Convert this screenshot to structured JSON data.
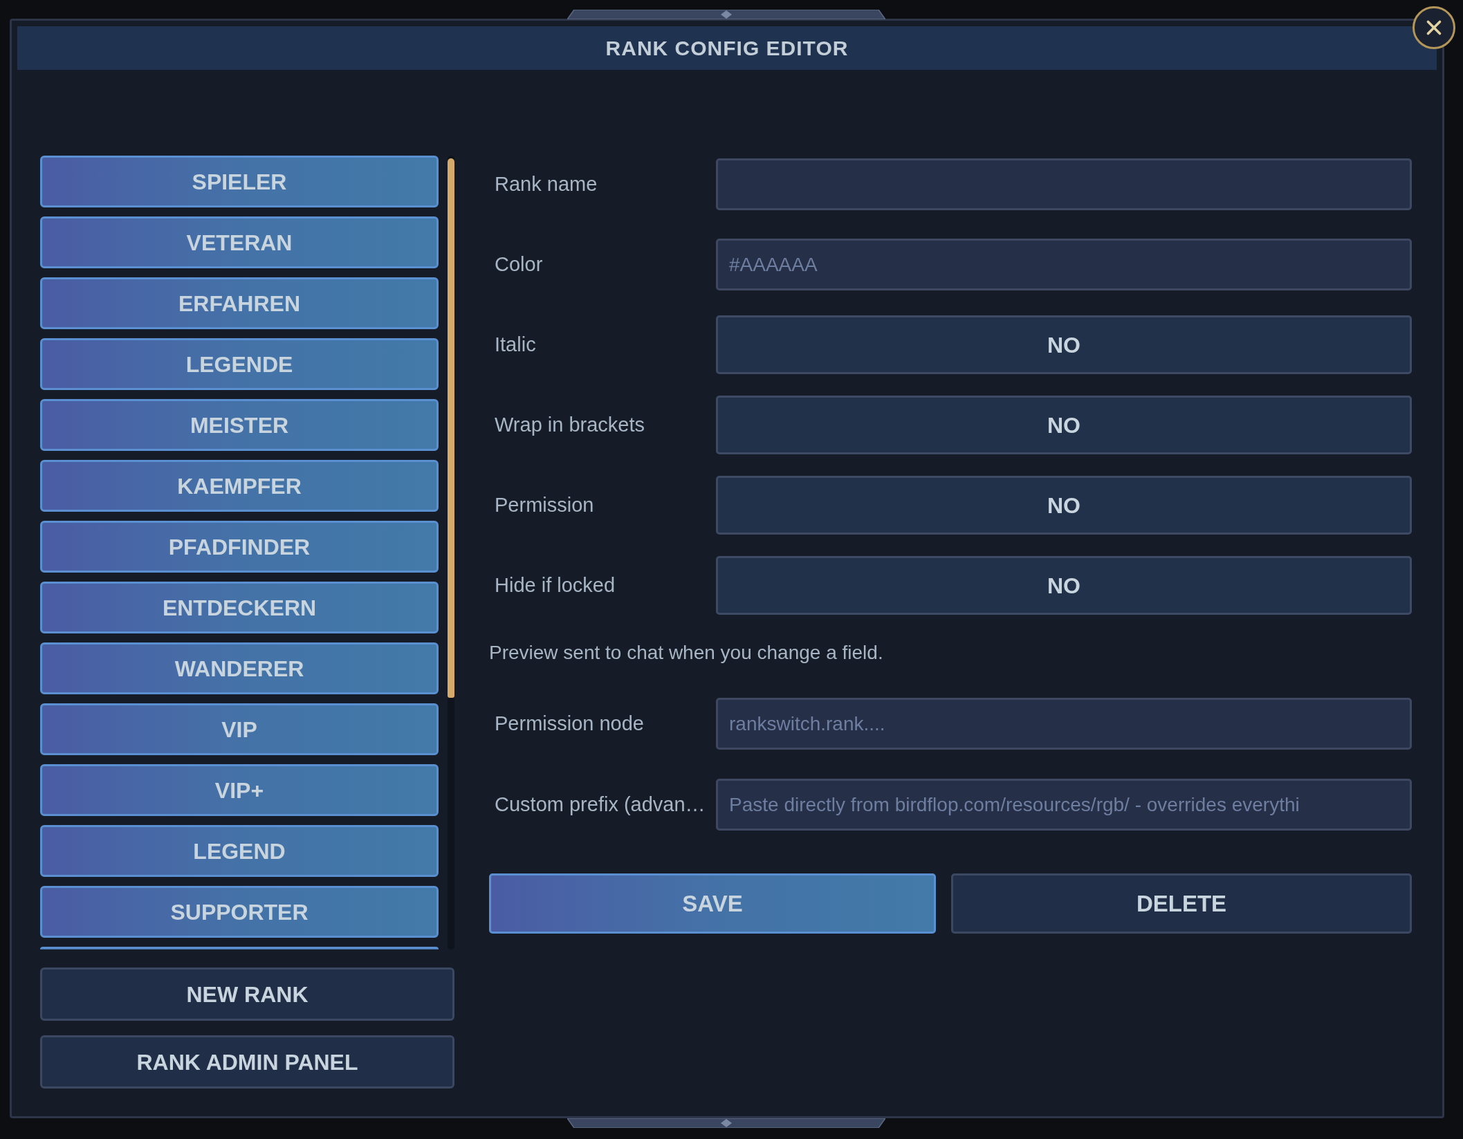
{
  "window": {
    "title": "RANK CONFIG EDITOR"
  },
  "ranks": [
    {
      "label": "SPIELER"
    },
    {
      "label": "VETERAN"
    },
    {
      "label": "ERFAHREN"
    },
    {
      "label": "LEGENDE"
    },
    {
      "label": "MEISTER"
    },
    {
      "label": "KAEMPFER"
    },
    {
      "label": "PFADFINDER"
    },
    {
      "label": "ENTDECKERN"
    },
    {
      "label": "WANDERER"
    },
    {
      "label": "VIP"
    },
    {
      "label": "VIP+"
    },
    {
      "label": "LEGEND"
    },
    {
      "label": "SUPPORTER"
    }
  ],
  "rank_actions": [
    {
      "label": "NEW RANK"
    },
    {
      "label": "RANK ADMIN PANEL"
    }
  ],
  "fields": [
    {
      "kind": "text",
      "label": "Rank name"
    },
    {
      "kind": "text",
      "label": "Color",
      "placeholder": "#AAAAAA"
    },
    {
      "kind": "toggle",
      "label": "Italic",
      "value": "NO"
    },
    {
      "kind": "toggle",
      "label": "Wrap in brackets",
      "value": "NO"
    },
    {
      "kind": "toggle",
      "label": "Permission",
      "value": "NO"
    },
    {
      "kind": "toggle",
      "label": "Hide if locked",
      "value": "NO"
    }
  ],
  "preview_note": "Preview sent to chat when you change a field.",
  "advanced_fields": [
    {
      "kind": "text",
      "label": "Permission node",
      "placeholder": "rankswitch.rank...."
    },
    {
      "kind": "text",
      "label": "Custom prefix (advan…",
      "placeholder": "Paste directly from birdflop.com/resources/rgb/ - overrides everythi"
    }
  ],
  "buttons": [
    {
      "kind": "primary",
      "label": "SAVE"
    },
    {
      "kind": "secondary",
      "label": "DELETE"
    }
  ]
}
